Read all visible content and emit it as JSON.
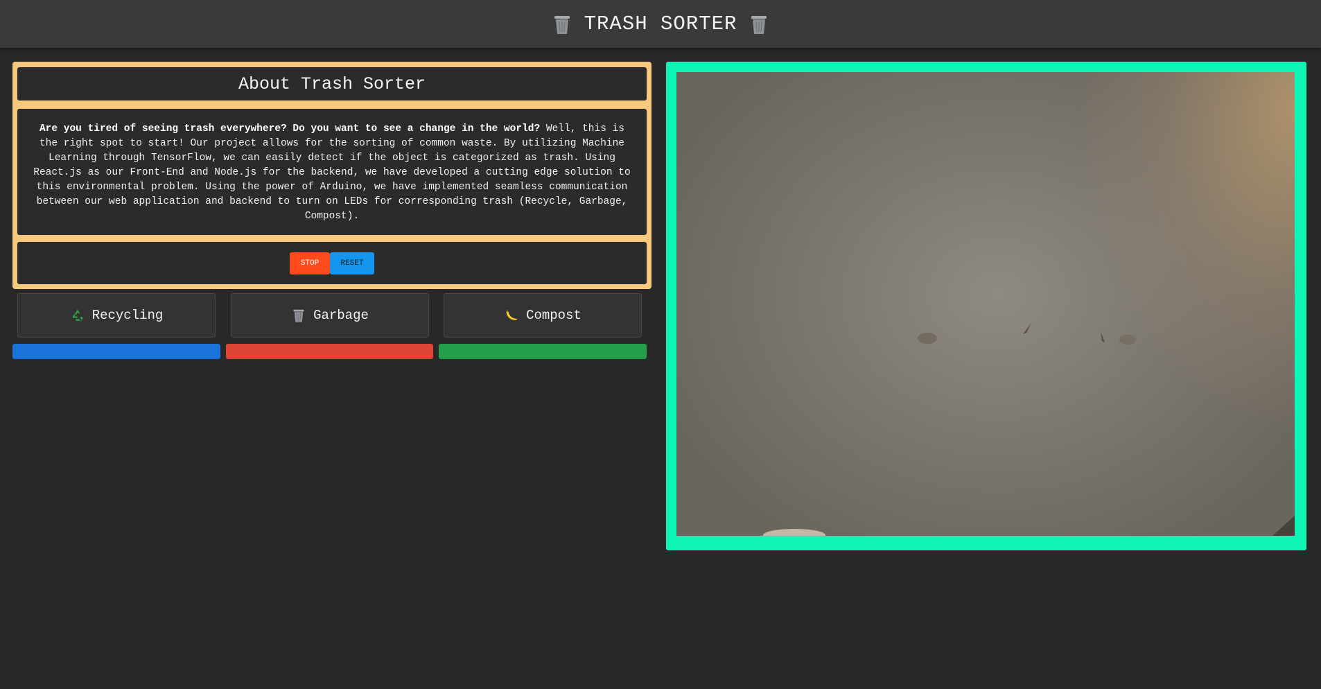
{
  "header": {
    "title": "TRASH SORTER",
    "left_icon": "trash-bin-icon",
    "right_icon": "trash-bin-icon"
  },
  "about": {
    "title": "About Trash Sorter",
    "intro_bold": "Are you tired of seeing trash everywhere? Do you want to see a change in the world?",
    "body": " Well, this is the right spot to start! Our project allows for the sorting of common waste. By utilizing Machine Learning through TensorFlow, we can easily detect if the object is categorized as trash. Using React.js as our Front-End and Node.js for the backend, we have developed a cutting edge solution to this environmental problem. Using the power of Arduino, we have implemented seamless communication between our web application and backend to turn on LEDs for corresponding trash (Recycle, Garbage, Compost)."
  },
  "controls": {
    "stop_label": "STOP",
    "reset_label": "RESET"
  },
  "categories": [
    {
      "label": "Recycling",
      "icon": "recycle-icon",
      "color": "#1a73d9"
    },
    {
      "label": "Garbage",
      "icon": "trash-bin-icon",
      "color": "#e04434"
    },
    {
      "label": "Compost",
      "icon": "banana-icon",
      "color": "#24a04c"
    }
  ],
  "colors": {
    "background": "#282828",
    "header": "#3a3a3a",
    "about_border": "#f7c97e",
    "camera_border": "#0ef5b5",
    "stop": "#ff4a1c",
    "reset": "#1496ee"
  }
}
